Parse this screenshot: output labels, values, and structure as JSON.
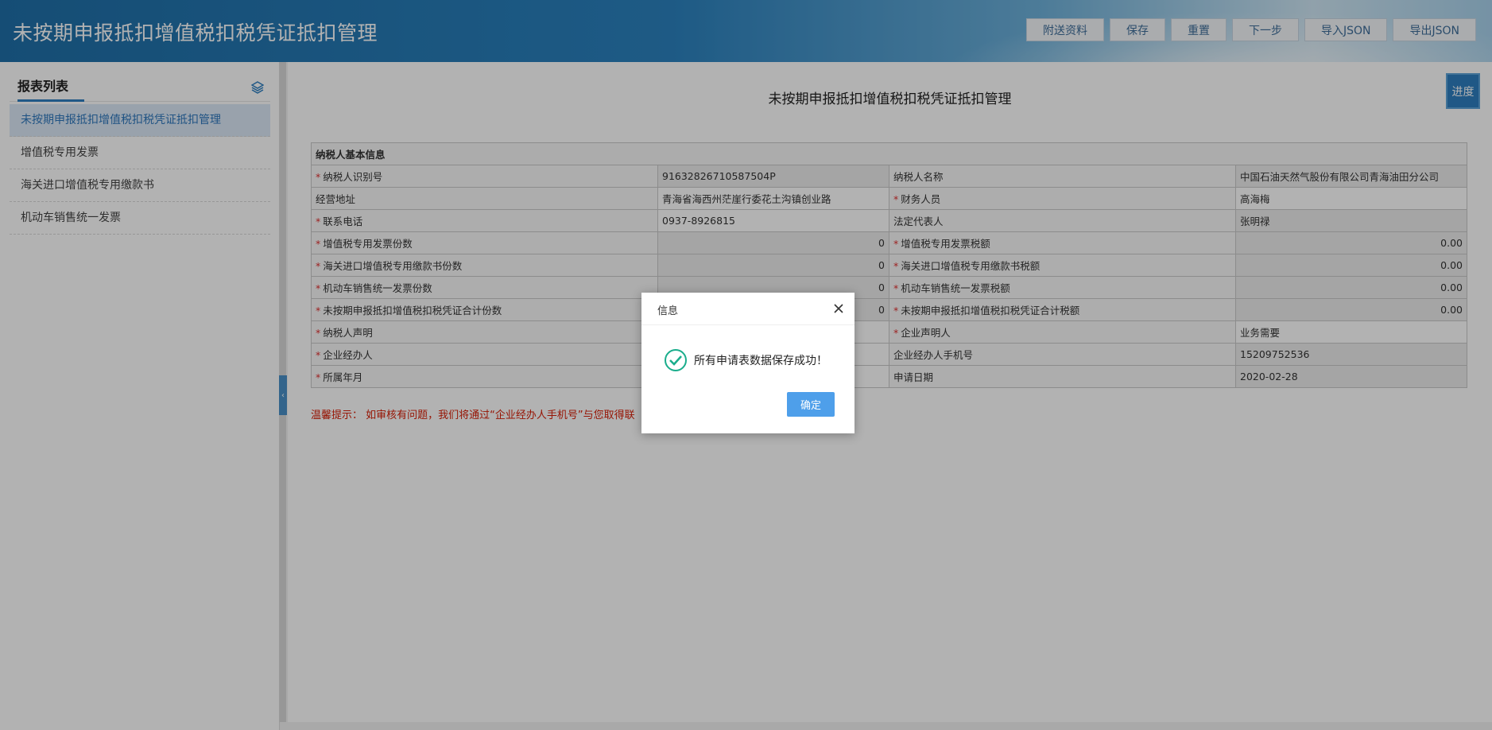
{
  "header": {
    "title": "未按期申报抵扣增值税扣税凭证抵扣管理",
    "buttons": [
      "附送资料",
      "保存",
      "重置",
      "下一步",
      "导入JSON",
      "导出JSON"
    ]
  },
  "sidebar": {
    "title": "报表列表",
    "layers_icon": "layers-icon",
    "items": [
      {
        "label": "未按期申报抵扣增值税扣税凭证抵扣管理",
        "active": true
      },
      {
        "label": "增值税专用发票",
        "active": false
      },
      {
        "label": "海关进口增值税专用缴款书",
        "active": false
      },
      {
        "label": "机动车销售统一发票",
        "active": false
      }
    ]
  },
  "main": {
    "page_title": "未按期申报抵扣增值税扣税凭证抵扣管理",
    "progress_label": "进度",
    "section_title": "纳税人基本信息",
    "rows": [
      {
        "l1": "纳税人识别号",
        "r1": true,
        "v1": "91632826710587504P",
        "l2": "纳税人名称",
        "r2": false,
        "v2": "中国石油天然气股份有限公司青海油田分公司"
      },
      {
        "l1": "经营地址",
        "r1": false,
        "v1": "青海省海西州茫崖行委花土沟镇创业路",
        "l2": "财务人员",
        "r2": true,
        "v2": "高海梅"
      },
      {
        "l1": "联系电话",
        "r1": true,
        "v1": "0937-8926815",
        "l2": "法定代表人",
        "r2": false,
        "v2": "张明禄"
      },
      {
        "l1": "增值税专用发票份数",
        "r1": true,
        "v1": "0",
        "l2": "增值税专用发票税额",
        "r2": true,
        "v2": "0.00"
      },
      {
        "l1": "海关进口增值税专用缴款书份数",
        "r1": true,
        "v1": "0",
        "l2": "海关进口增值税专用缴款书税额",
        "r2": true,
        "v2": "0.00"
      },
      {
        "l1": "机动车销售统一发票份数",
        "r1": true,
        "v1": "0",
        "l2": "机动车销售统一发票税额",
        "r2": true,
        "v2": "0.00"
      },
      {
        "l1": "未按期申报抵扣增值税扣税凭证合计份数",
        "r1": true,
        "v1": "0",
        "l2": "未按期申报抵扣增值税扣税凭证合计税额",
        "r2": true,
        "v2": "0.00"
      },
      {
        "l1": "纳税人声明",
        "r1": true,
        "v1": "",
        "l2": "企业声明人",
        "r2": true,
        "v2": "业务需要"
      },
      {
        "l1": "企业经办人",
        "r1": true,
        "v1": "",
        "l2": "企业经办人手机号",
        "r2": false,
        "v2": "15209752536"
      },
      {
        "l1": "所属年月",
        "r1": true,
        "v1": "",
        "l2": "申请日期",
        "r2": false,
        "v2": "2020-02-28"
      }
    ],
    "tip": "温馨提示： 如审核有问题，我们将通过“企业经办人手机号”与您取得联"
  },
  "dialog": {
    "title": "信息",
    "message": "所有申请表数据保存成功！",
    "ok_label": "确定",
    "success_color": "#1aad8c"
  }
}
